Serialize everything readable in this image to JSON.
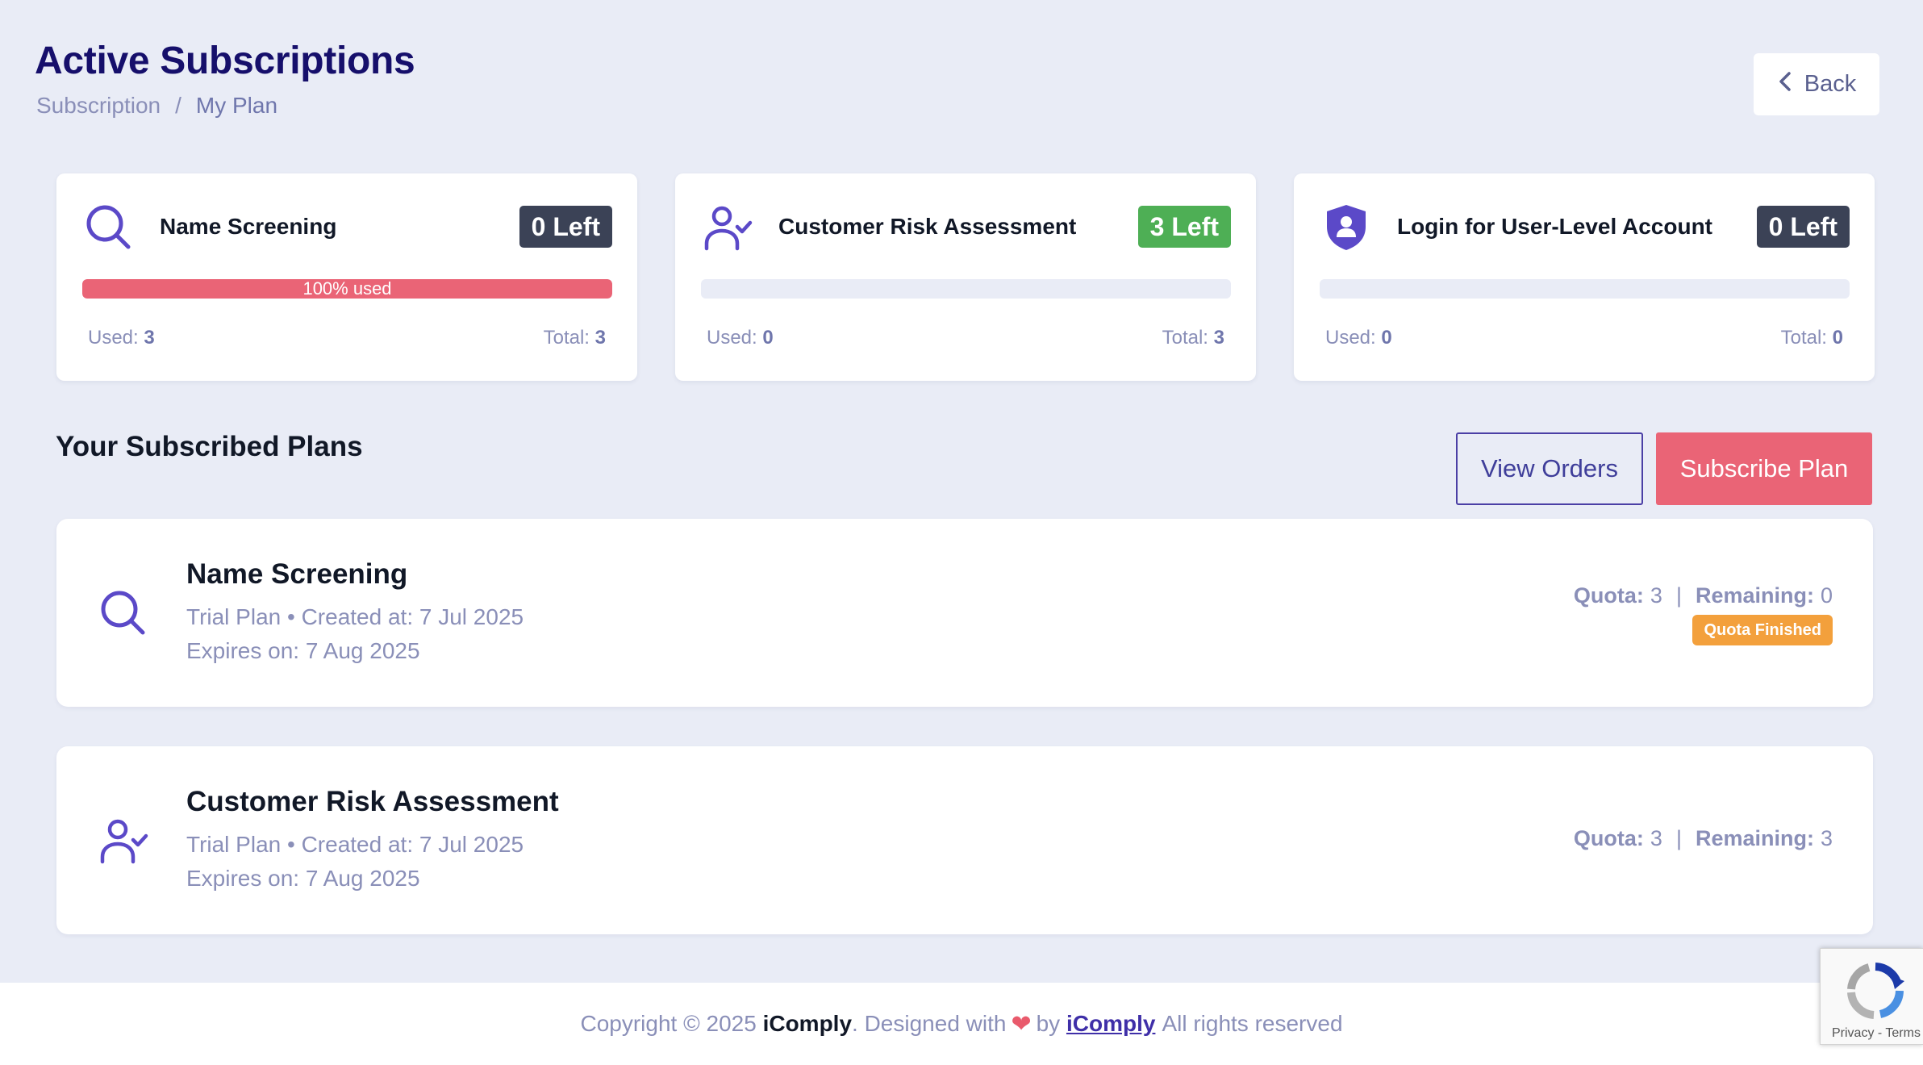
{
  "header": {
    "title": "Active Subscriptions",
    "breadcrumb": [
      "Subscription",
      "My Plan"
    ],
    "breadcrumb_separator": "/",
    "back_label": "Back",
    "back_icon": "chevron-left-icon"
  },
  "stats": [
    {
      "title": "Name Screening",
      "icon": "search-icon",
      "left_label": "0 Left",
      "left_color": "#3b4256",
      "progress_fraction": 1.0,
      "progress_label": "100% used",
      "used_label": "Used:",
      "used_value": "3",
      "total_label": "Total:",
      "total_value": "3"
    },
    {
      "title": "Customer Risk Assessment",
      "icon": "user-check-icon",
      "left_label": "3 Left",
      "left_color": "#4eaf55",
      "progress_fraction": 0,
      "progress_label": "",
      "used_label": "Used:",
      "used_value": "0",
      "total_label": "Total:",
      "total_value": "3"
    },
    {
      "title": "Login for User-Level Account",
      "icon": "shield-user-icon",
      "left_label": "0 Left",
      "left_color": "#3b4256",
      "progress_fraction": 0,
      "progress_label": "",
      "used_label": "Used:",
      "used_value": "0",
      "total_label": "Total:",
      "total_value": "0"
    }
  ],
  "section": {
    "title": "Your Subscribed Plans",
    "view_orders_label": "View Orders",
    "subscribe_label": "Subscribe Plan"
  },
  "plans": [
    {
      "name": "Name Screening",
      "icon": "search-icon",
      "meta_line1": "Trial Plan • Created at: 7 Jul 2025",
      "meta_line2": "Expires on: 7 Aug 2025",
      "quota_label": "Quota:",
      "quota_value": "3",
      "remaining_label": "Remaining:",
      "remaining_value": "0",
      "status": "Quota Finished"
    },
    {
      "name": "Customer Risk Assessment",
      "icon": "user-check-icon",
      "meta_line1": "Trial Plan • Created at: 7 Jul 2025",
      "meta_line2": "Expires on: 7 Aug 2025",
      "quota_label": "Quota:",
      "quota_value": "3",
      "remaining_label": "Remaining:",
      "remaining_value": "3",
      "status": ""
    }
  ],
  "footer": {
    "prefix": "Copyright © 2025",
    "brand": "iComply",
    "middle": ". Designed with",
    "by": "by",
    "link": "iComply",
    "suffix": "All rights reserved"
  },
  "recaptcha": {
    "links": "Privacy - Terms"
  },
  "colors": {
    "accent": "#4b3fa5",
    "danger": "#ea6476",
    "warning": "#f3a03c",
    "success": "#4eaf55",
    "title": "#160f6b"
  }
}
